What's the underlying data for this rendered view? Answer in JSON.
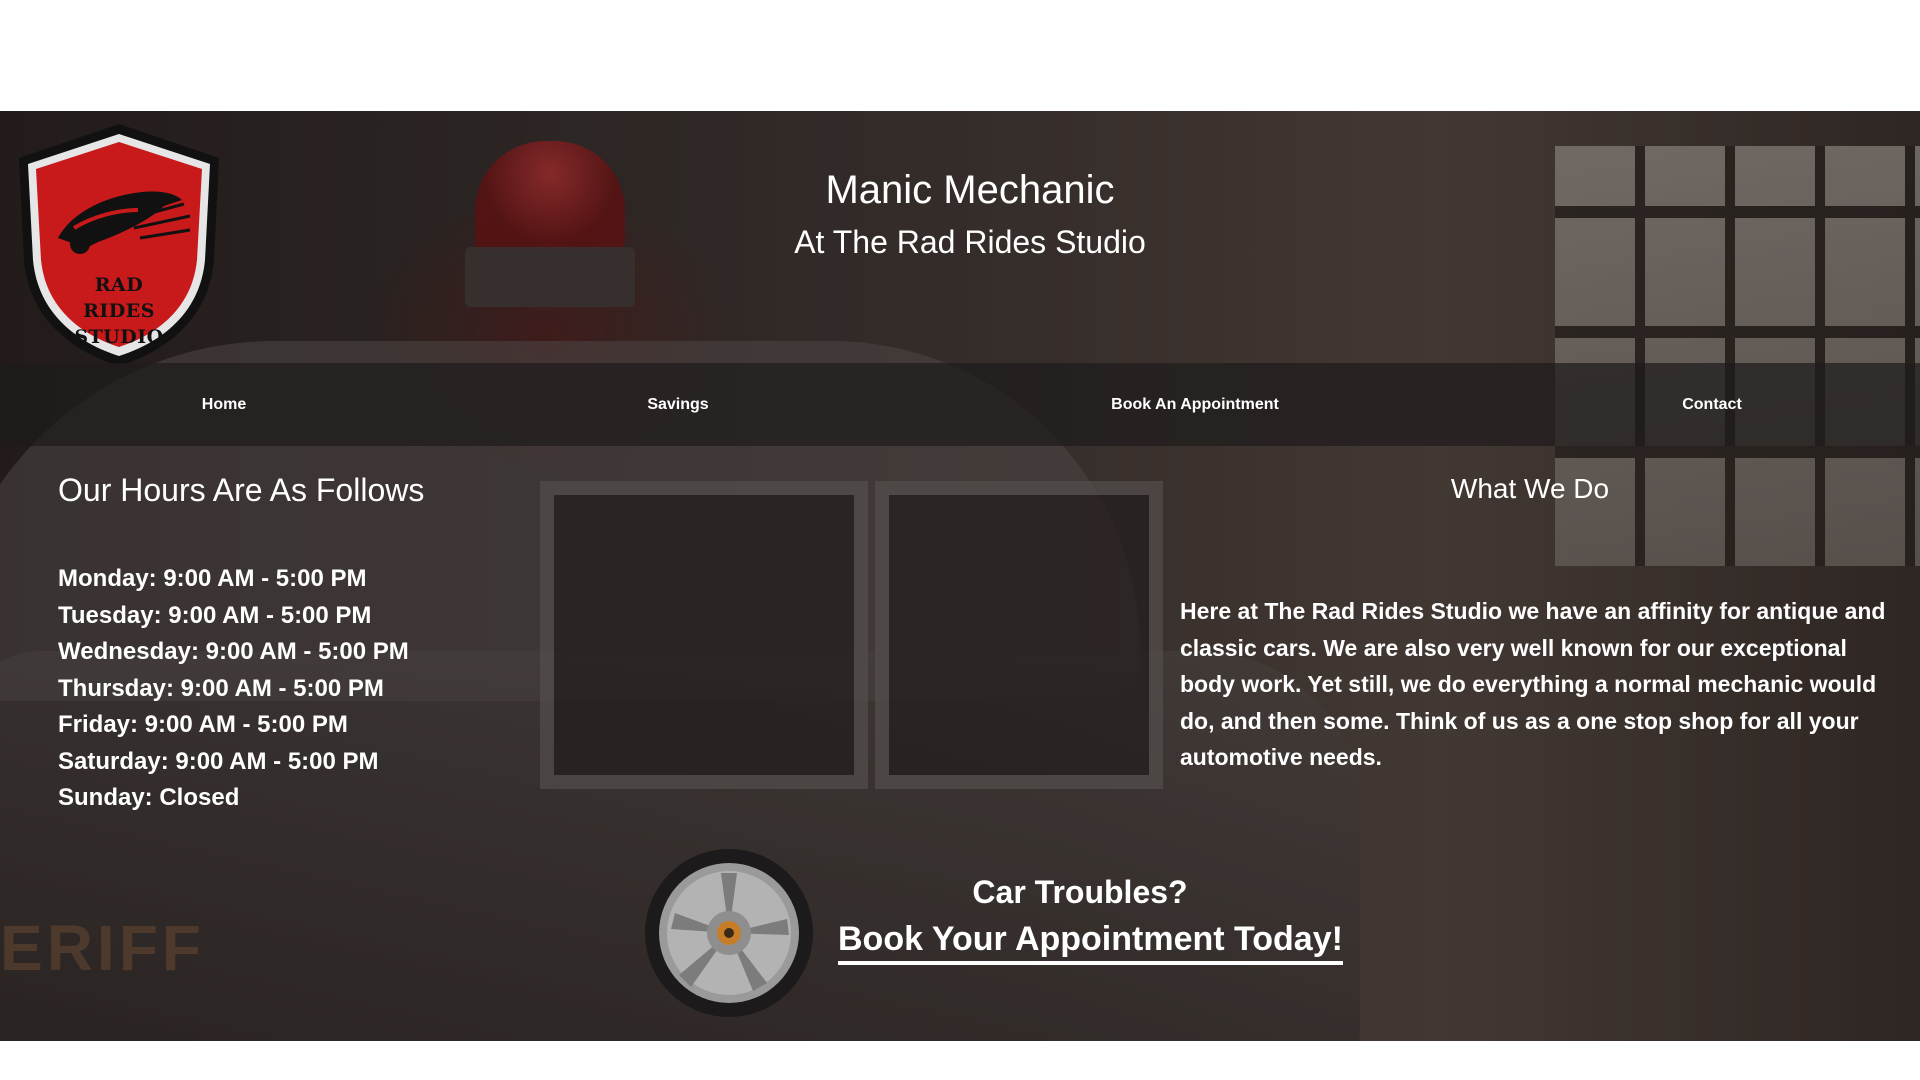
{
  "header": {
    "logo_text_line1": "RAD RIDES",
    "logo_text_line2": "STUDIO",
    "title": "Manic Mechanic",
    "subtitle": "At The Rad Rides Studio"
  },
  "nav": {
    "items": [
      {
        "label": "Home"
      },
      {
        "label": "Savings"
      },
      {
        "label": "Book An Appointment"
      },
      {
        "label": "Contact"
      }
    ]
  },
  "hours": {
    "heading": "Our Hours Are As Follows",
    "lines": [
      "Monday: 9:00 AM - 5:00 PM",
      "Tuesday: 9:00 AM - 5:00 PM",
      "Wednesday: 9:00 AM - 5:00 PM",
      "Thursday: 9:00 AM - 5:00 PM",
      "Friday: 9:00 AM - 5:00 PM",
      "Saturday: 9:00 AM - 5:00 PM",
      "Sunday: Closed"
    ]
  },
  "what_we_do": {
    "heading": "What We Do",
    "body": "Here at The Rad Rides Studio we have an affinity for antique and classic cars. We are also very well known for our exceptional body work. Yet still, we do everything a normal mechanic would do, and then some. Think of us as a one stop shop for all your automotive needs."
  },
  "cta": {
    "title": "Car Troubles?",
    "link": "Book Your Appointment Today!"
  },
  "background_text": "ERIFF",
  "colors": {
    "logo_red": "#c8191b",
    "nav_bg": "#1e1c1c",
    "text": "#ffffff"
  },
  "icons": {
    "logo": "shield-car-logo-icon",
    "wheel": "wheel-icon"
  }
}
